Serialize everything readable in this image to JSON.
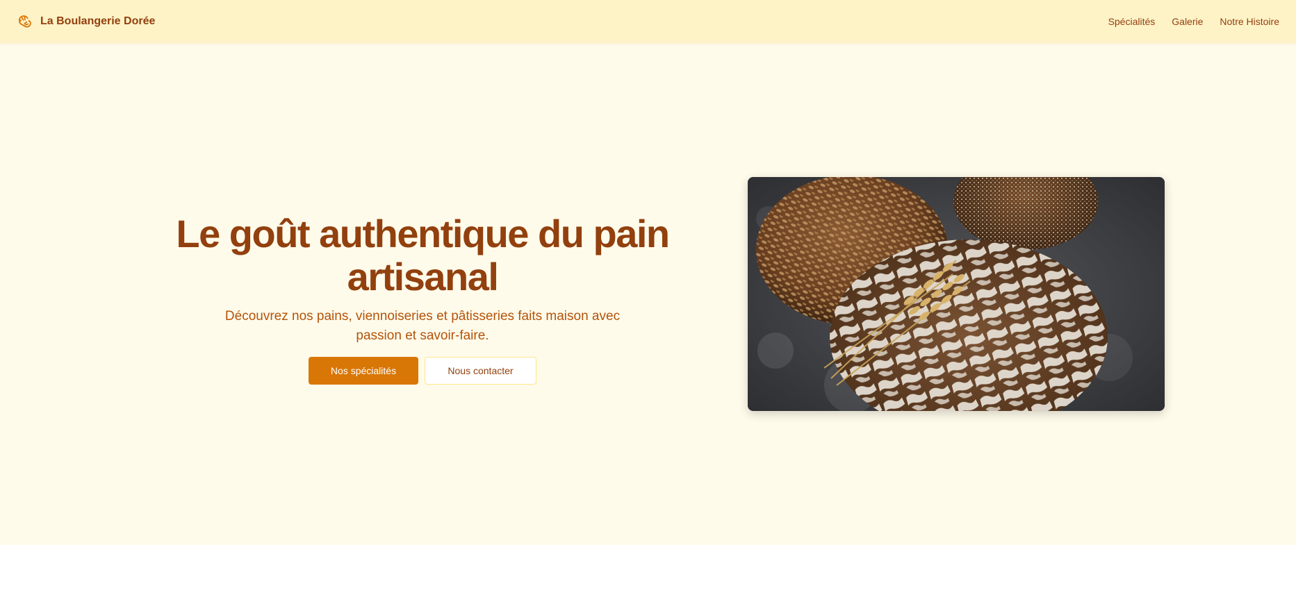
{
  "brand": {
    "name": "La Boulangerie Dorée",
    "icon": "croissant-icon"
  },
  "nav": {
    "links": [
      "Spécialités",
      "Galerie",
      "Notre Histoire"
    ]
  },
  "hero": {
    "title": "Le goût authentique du pain artisanal",
    "subtitle": "Découvrez nos pains, viennoiseries et pâtisseries faits maison avec passion et savoir-faire.",
    "primary_button": "Nos spécialités",
    "secondary_button": "Nous contacter",
    "image_alt": "Pains artisanaux et épis de blé"
  },
  "colors": {
    "navbar_bg": "#fef3c7",
    "hero_bg": "#fffbeb",
    "brand_text": "#92400e",
    "accent": "#d97706",
    "subtitle": "#b45309",
    "button_border": "#fde68a"
  }
}
